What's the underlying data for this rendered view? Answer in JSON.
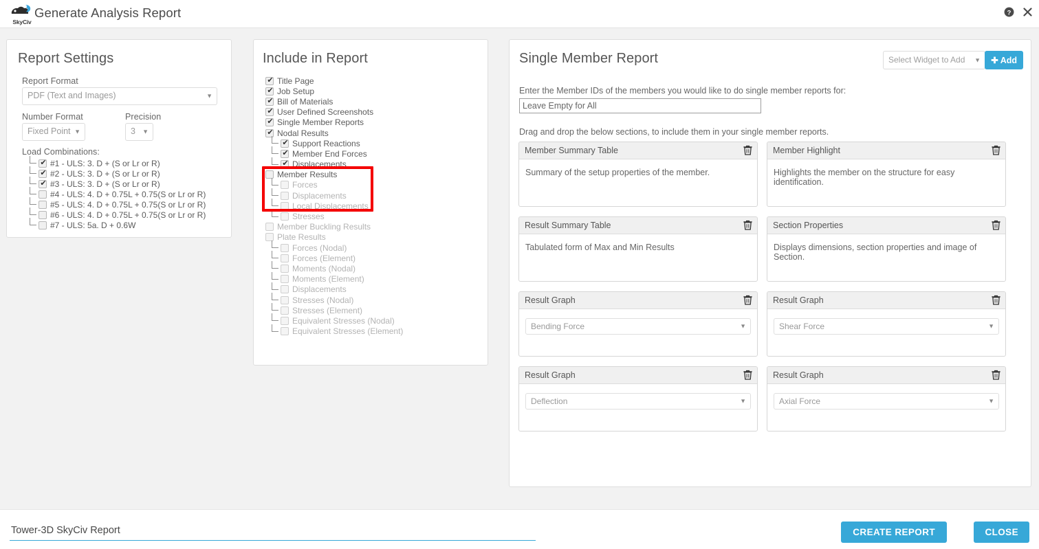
{
  "header": {
    "title": "Generate Analysis Report",
    "logo_text": "SkyCiv",
    "help_icon": "help-circle-icon",
    "close_icon": "close-icon"
  },
  "report_settings": {
    "title": "Report Settings",
    "report_format_label": "Report Format",
    "report_format_value": "PDF (Text and Images)",
    "number_format_label": "Number Format",
    "number_format_value": "Fixed Point",
    "precision_label": "Precision",
    "precision_value": "3",
    "load_combinations_label": "Load Combinations:",
    "load_combinations": [
      {
        "label": "#1 - ULS: 3. D + (S or Lr or R)",
        "checked": true
      },
      {
        "label": "#2 - ULS: 3. D + (S or Lr or R)",
        "checked": true
      },
      {
        "label": "#3 - ULS: 3. D + (S or Lr or R)",
        "checked": true
      },
      {
        "label": "#4 - ULS: 4. D + 0.75L + 0.75(S or Lr or R)",
        "checked": false
      },
      {
        "label": "#5 - ULS: 4. D + 0.75L + 0.75(S or Lr or R)",
        "checked": false
      },
      {
        "label": "#6 - ULS: 4. D + 0.75L + 0.75(S or Lr or R)",
        "checked": false
      },
      {
        "label": "#7 - ULS: 5a. D + 0.6W",
        "checked": false
      }
    ]
  },
  "include_in_report": {
    "title": "Include in Report",
    "highlight_color": "#f40000",
    "items": [
      {
        "label": "Title Page",
        "checked": true,
        "level": 0,
        "disabled": false
      },
      {
        "label": "Job Setup",
        "checked": true,
        "level": 0,
        "disabled": false
      },
      {
        "label": "Bill of Materials",
        "checked": true,
        "level": 0,
        "disabled": false
      },
      {
        "label": "User Defined Screenshots",
        "checked": true,
        "level": 0,
        "disabled": false
      },
      {
        "label": "Single Member Reports",
        "checked": true,
        "level": 0,
        "disabled": false
      },
      {
        "label": "Nodal Results",
        "checked": true,
        "level": 0,
        "disabled": false
      },
      {
        "label": "Support Reactions",
        "checked": true,
        "level": 1,
        "disabled": false
      },
      {
        "label": "Member End Forces",
        "checked": true,
        "level": 1,
        "disabled": false
      },
      {
        "label": "Displacements",
        "checked": true,
        "level": 1,
        "disabled": false,
        "last": true
      },
      {
        "label": "Member Results",
        "checked": false,
        "level": 0,
        "disabled": false
      },
      {
        "label": "Forces",
        "checked": false,
        "level": 1,
        "disabled": true
      },
      {
        "label": "Displacements",
        "checked": false,
        "level": 1,
        "disabled": true
      },
      {
        "label": "Local Displacements",
        "checked": false,
        "level": 1,
        "disabled": true
      },
      {
        "label": "Stresses",
        "checked": false,
        "level": 1,
        "disabled": true,
        "last": true
      },
      {
        "label": "Member Buckling Results",
        "checked": false,
        "level": 0,
        "disabled": true
      },
      {
        "label": "Plate Results",
        "checked": false,
        "level": 0,
        "disabled": true
      },
      {
        "label": "Forces (Nodal)",
        "checked": false,
        "level": 1,
        "disabled": true
      },
      {
        "label": "Forces (Element)",
        "checked": false,
        "level": 1,
        "disabled": true
      },
      {
        "label": "Moments (Nodal)",
        "checked": false,
        "level": 1,
        "disabled": true
      },
      {
        "label": "Moments (Element)",
        "checked": false,
        "level": 1,
        "disabled": true
      },
      {
        "label": "Displacements",
        "checked": false,
        "level": 1,
        "disabled": true
      },
      {
        "label": "Stresses (Nodal)",
        "checked": false,
        "level": 1,
        "disabled": true
      },
      {
        "label": "Stresses (Element)",
        "checked": false,
        "level": 1,
        "disabled": true
      },
      {
        "label": "Equivalent Stresses (Nodal)",
        "checked": false,
        "level": 1,
        "disabled": true
      },
      {
        "label": "Equivalent Stresses (Element)",
        "checked": false,
        "level": 1,
        "disabled": true,
        "last": true
      }
    ]
  },
  "single_member_report": {
    "title": "Single Member Report",
    "widget_select_value": "Select Widget to Add",
    "add_button_label": "Add",
    "instruction": "Enter the Member IDs of the members you would like to do single member reports for:",
    "member_ids_placeholder": "Leave Empty for All",
    "member_ids_value": "",
    "drag_note": "Drag and drop the below sections, to include them in your single member reports.",
    "widgets": [
      {
        "title": "Member Summary Table",
        "description": "Summary of the setup properties of the member.",
        "select_value": null,
        "delete_icon": "trash-icon"
      },
      {
        "title": "Member Highlight",
        "description": "Highlights the member on the structure for easy identification.",
        "select_value": null,
        "delete_icon": "trash-icon"
      },
      {
        "title": "Result Summary Table",
        "description": "Tabulated form of Max and Min Results",
        "select_value": null,
        "delete_icon": "trash-icon"
      },
      {
        "title": "Section Properties",
        "description": "Displays dimensions, section properties and image of Section.",
        "select_value": null,
        "delete_icon": "trash-icon"
      },
      {
        "title": "Result Graph",
        "description": null,
        "select_value": "Bending Force",
        "delete_icon": "trash-icon"
      },
      {
        "title": "Result Graph",
        "description": null,
        "select_value": "Shear Force",
        "delete_icon": "trash-icon"
      },
      {
        "title": "Result Graph",
        "description": null,
        "select_value": "Deflection",
        "delete_icon": "trash-icon"
      },
      {
        "title": "Result Graph",
        "description": null,
        "select_value": "Axial Force",
        "delete_icon": "trash-icon"
      }
    ]
  },
  "footer": {
    "report_name_value": "Tower-3D SkyCiv Report",
    "create_report_label": "CREATE REPORT",
    "close_label": "CLOSE",
    "accent_color": "#37a8d8"
  }
}
